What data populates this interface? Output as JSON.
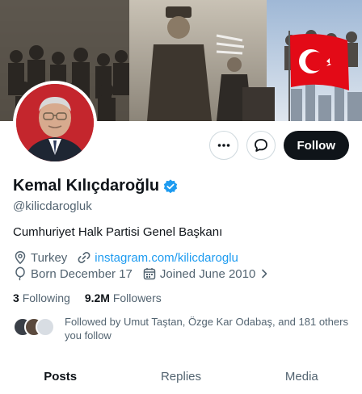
{
  "profile": {
    "display_name": "Kemal Kılıçdaroğlu",
    "handle": "@kilicdarogluk",
    "bio": "Cumhuriyet Halk Partisi Genel Başkanı",
    "verified": true,
    "location": "Turkey",
    "website": "instagram.com/kilicdaroglu",
    "birthday": "Born December 17",
    "joined": "Joined June 2010"
  },
  "actions": {
    "more_icon": "more-icon",
    "message_icon": "message-icon",
    "follow_label": "Follow"
  },
  "stats": {
    "following_count": "3",
    "following_label": "Following",
    "followers_count": "9.2M",
    "followers_label": "Followers"
  },
  "followed_by": {
    "text": "Followed by Umut Taştan, Özge Kar Odabaş, and 181 others you follow"
  },
  "tabs": [
    {
      "label": "Posts",
      "active": true
    },
    {
      "label": "Replies",
      "active": false
    },
    {
      "label": "Media",
      "active": false
    }
  ],
  "colors": {
    "accent": "#1d9bf0",
    "text_primary": "#0f1419",
    "text_secondary": "#536471",
    "follow_button": "#0f1419"
  }
}
